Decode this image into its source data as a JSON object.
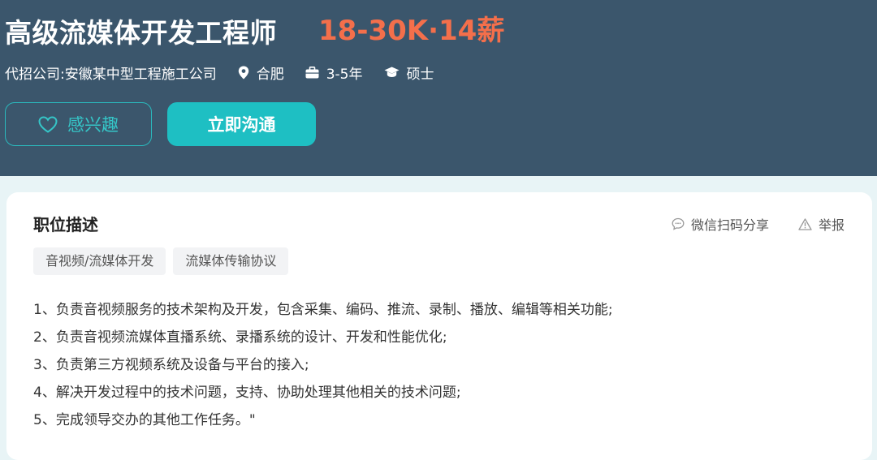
{
  "job": {
    "title": "高级流媒体开发工程师",
    "salary": "18-30K·14薪",
    "company": "代招公司:安徽某中型工程施工公司",
    "location": "合肥",
    "experience": "3-5年",
    "education": "硕士"
  },
  "buttons": {
    "interest_label": "感兴趣",
    "chat_label": "立即沟通"
  },
  "description": {
    "section_title": "职位描述",
    "share_label": "微信扫码分享",
    "report_label": "举报",
    "tags": [
      "音视频/流媒体开发",
      "流媒体传输协议"
    ],
    "lines": [
      "1、负责音视频服务的技术架构及开发，包含采集、编码、推流、录制、播放、编辑等相关功能;",
      "2、负责音视频流媒体直播系统、录播系统的设计、开发和性能优化;",
      "3、负责第三方视频系统及设备与平台的接入;",
      "4、解决开发过程中的技术问题，支持、协助处理其他相关的技术问题;",
      "5、完成领导交办的其他工作任务。\""
    ]
  },
  "icons": {
    "location": "location-pin-icon",
    "experience": "briefcase-icon",
    "education": "graduation-cap-icon",
    "interest": "heart-icon",
    "share": "chat-bubble-icon",
    "report": "warning-triangle-icon"
  },
  "colors": {
    "header_bg": "#3b566c",
    "salary": "#f46f4b",
    "accent": "#1ebfc3"
  }
}
